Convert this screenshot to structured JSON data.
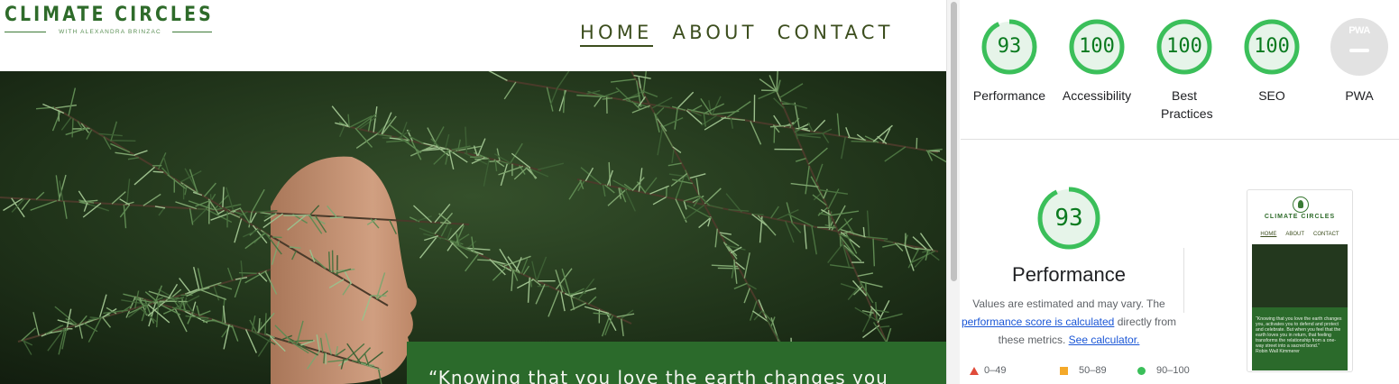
{
  "site": {
    "logo": {
      "title": "CLIMATE CIRCLES",
      "subtitle": "WITH ALEXANDRA BRINZAC"
    },
    "nav": [
      {
        "label": "HOME",
        "active": true
      },
      {
        "label": "ABOUT",
        "active": false
      },
      {
        "label": "CONTACT",
        "active": false
      }
    ],
    "hero": {
      "quote": "“Knowing that you love the earth changes you"
    }
  },
  "lighthouse": {
    "categories": [
      {
        "label": "Performance",
        "score": "93",
        "fraction": 0.93
      },
      {
        "label": "Accessibility",
        "score": "100",
        "fraction": 1.0
      },
      {
        "label": "Best Practices",
        "score": "100",
        "fraction": 1.0
      },
      {
        "label": "SEO",
        "score": "100",
        "fraction": 1.0
      },
      {
        "label": "PWA",
        "score": "PWA",
        "fraction": 0
      }
    ],
    "performance": {
      "score": "93",
      "fraction": 0.93,
      "title": "Performance",
      "desc_prefix": "Values are estimated and may vary. The ",
      "desc_link1": "performance score is calculated",
      "desc_middle": " directly from these metrics. ",
      "desc_link2": "See calculator."
    },
    "legend": [
      {
        "range": "0–49",
        "shape": "triangle",
        "color": "#e04b3a"
      },
      {
        "range": "50–89",
        "shape": "square",
        "color": "#f4a92a"
      },
      {
        "range": "90–100",
        "shape": "circle",
        "color": "#3bbf5a"
      }
    ],
    "thumbnail": {
      "title": "CLIMATE CIRCLES",
      "nav": [
        "HOME",
        "ABOUT",
        "CONTACT"
      ],
      "quote": "“Knowing that you love the earth changes you, activates you to defend and protect and celebrate. But when you feel that the earth loves you in return, that feeling transforms the relationship from a one-way street into a sacred bond.”",
      "attribution": "Robin Wall Kimmerer"
    }
  },
  "colors": {
    "brand_green": "#2e6b2a",
    "nav_text": "#3c4e1e",
    "score_green": "#0a7a1f",
    "gauge_ring": "#3bbf5a",
    "gauge_fill": "#e6f4e9",
    "link": "#1a56d6"
  }
}
